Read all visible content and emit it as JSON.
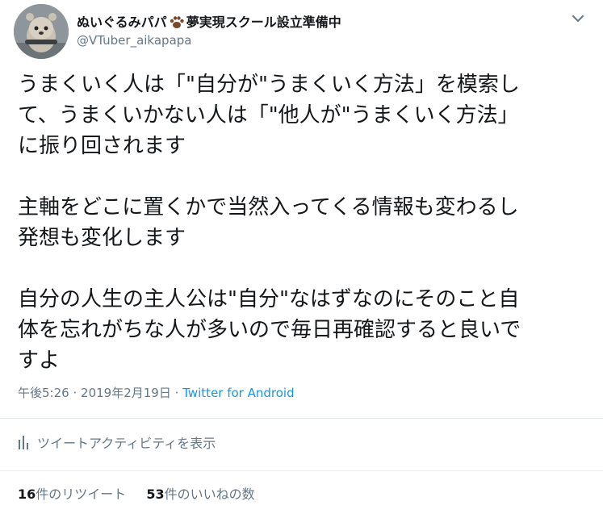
{
  "author": {
    "display_name": "ぬいぐるみパパ",
    "name_suffix": "夢実現スクール設立準備中",
    "handle": "@VTuber_aikapapa"
  },
  "tweet": {
    "paragraphs": [
      "うまくいく人は「\"自分が\"うまくいく方法」を模索し\nて、うまくいかない人は「\"他人が\"うまくいく方法」\nに振り回されます",
      "主軸をどこに置くかで当然入ってくる情報も変わるし\n発想も変化します",
      "自分の人生の主人公は\"自分\"なはずなのにそのこと自\n体を忘れがちな人が多いので毎日再確認すると良いで\nすよ"
    ]
  },
  "meta": {
    "time": "午後5:26",
    "separator": "·",
    "date": "2019年2月19日",
    "source": "Twitter for Android"
  },
  "activity": {
    "label": "ツイートアクティビティを表示",
    "icon": "analytics-bar-icon"
  },
  "stats": {
    "retweets_count": "16",
    "retweets_label": "件のリツイート",
    "likes_count": "53",
    "likes_label": "件のいいねの数"
  },
  "colors": {
    "text": "#14171a",
    "secondary": "#657786",
    "link": "#1b95e0",
    "divider": "#e6ecf0"
  }
}
